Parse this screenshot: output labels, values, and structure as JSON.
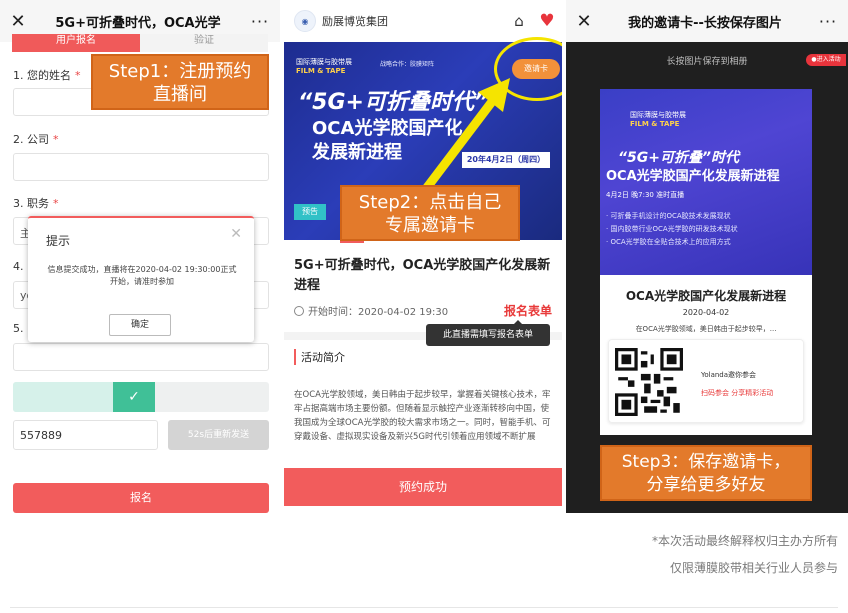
{
  "panel1": {
    "close_icon": "close-icon",
    "title": "5G+可折叠时代，OCA光学",
    "more_icon": "more-icon",
    "tabs": [
      "用户报名",
      "验证"
    ],
    "fields": [
      {
        "label": "1. 您的姓名",
        "required": true,
        "value": ""
      },
      {
        "label": "2. 公司",
        "required": true,
        "value": ""
      },
      {
        "label": "3. 职务",
        "required": true,
        "value": "主"
      },
      {
        "label": "4.",
        "required": false,
        "value": "yo"
      },
      {
        "label": "5.",
        "required": false,
        "value": ""
      }
    ],
    "verify_code": "557889",
    "resend_button": "52s后重新发送",
    "submit_button": "报名",
    "dialog": {
      "title": "提示",
      "message": "信息提交成功，直播将在2020-04-02 19:30:00正式开始，请准时参加",
      "confirm": "确定"
    },
    "callout": [
      "Step1：注册预约",
      "直播间"
    ]
  },
  "panel2": {
    "brand_name": "励展博览集团",
    "banner": {
      "org_line1": "国际薄膜与胶带展",
      "org_line2": "FILM & TAPE",
      "coop": "战略合作：胶膜矩阵",
      "headline1": "“5G+可折叠时代”",
      "headline2": "OCA光学胶国产化",
      "headline3": "发展新进程",
      "date": "20年4月2日（周四）",
      "tag": "预告",
      "invite_button": "邀请卡"
    },
    "callout": [
      "Step2：点击自己",
      "专属邀请卡"
    ],
    "title": "5G+可折叠时代，OCA光学胶国产化发展新进程",
    "start_time": "开始时间：2020-04-02 19:30",
    "form_link": "报名表单",
    "tooltip": "此直播需填写报名表单",
    "section_title": "活动简介",
    "description": "在OCA光学胶领域，美日韩由于起步较早，掌握着关键核心技术，牢牢占据高端市场主要份额。但随着显示触控产业逐渐转移向中国，使我国成为全球OCA光学胶的较大需求市场之一。同时，智能手机、可穿戴设备、虚拟现实设备及新兴5G时代引领着应用领域不断扩展",
    "book_button": "预约成功"
  },
  "panel3": {
    "close_icon": "close-icon",
    "title": "我的邀请卡--长按保存图片",
    "more_icon": "more-icon",
    "save_hint": "长按图片保存到相册",
    "live_badge": "●进入活动",
    "card": {
      "org_line1": "国际薄膜与胶带展",
      "org_line2": "FILM & TAPE",
      "headline1": "“5G+可折叠”时代",
      "headline2": "OCA光学胶国产化发展新进程",
      "date_line": "4月2日 晚7:30 准时直播",
      "bullets": [
        "· 可折叠手机设计的OCA胶技术发展现状",
        "· 国内胶带行业OCA光学胶的研发技术现状",
        "· OCA光学胶在全贴合技术上的应用方式"
      ],
      "name": "OCA光学胶国产化发展新进程",
      "date": "2020-04-02",
      "subtitle": "在OCA光学胶领域，美日韩由于起步较早，...",
      "inviter": "Yolanda邀你参会",
      "cta": "扫码参会 分享精彩活动"
    },
    "callout": [
      "Step3：保存邀请卡，",
      "分享给更多好友"
    ]
  },
  "footer": {
    "line1": "*本次活动最终解释权归主办方所有",
    "line2": "仅限薄膜胶带相关行业人员参与"
  }
}
